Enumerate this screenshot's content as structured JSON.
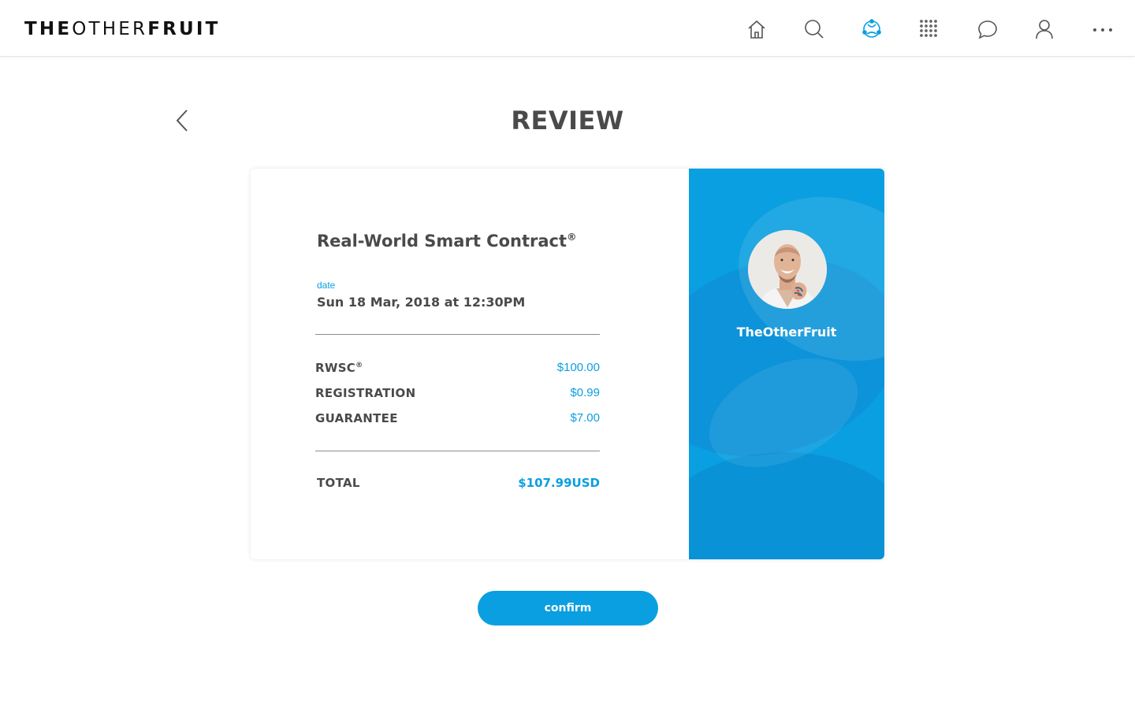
{
  "brand": {
    "part1": "THE",
    "part2": "OTHER",
    "part3": "FRUIT"
  },
  "nav": {
    "items": [
      {
        "name": "home",
        "icon": "home-icon"
      },
      {
        "name": "search",
        "icon": "search-icon"
      },
      {
        "name": "network",
        "icon": "network-icon",
        "active": true
      },
      {
        "name": "apps",
        "icon": "grid-dots-icon"
      },
      {
        "name": "messages",
        "icon": "chat-bubble-icon"
      },
      {
        "name": "profile",
        "icon": "user-icon"
      },
      {
        "name": "more",
        "icon": "more-dots-icon"
      }
    ]
  },
  "colors": {
    "accent": "#0a9fe0",
    "text": "#4a4a4a",
    "divider": "#8c8c8c"
  },
  "page": {
    "title": "REVIEW"
  },
  "contract": {
    "title": "Real-World Smart Contract",
    "title_mark": "®",
    "date_label": "date",
    "date_value": "Sun 18 Mar, 2018 at 12:30PM",
    "line_items": [
      {
        "label": "RWSC",
        "mark": "®",
        "amount": "$100.00"
      },
      {
        "label": "REGISTRATION",
        "mark": "",
        "amount": "$0.99"
      },
      {
        "label": "GUARANTEE",
        "mark": "",
        "amount": "$7.00"
      }
    ],
    "total_label": "TOTAL",
    "total_amount": "$107.99USD"
  },
  "profile": {
    "name": "TheOtherFruit"
  },
  "actions": {
    "confirm_label": "confirm"
  }
}
